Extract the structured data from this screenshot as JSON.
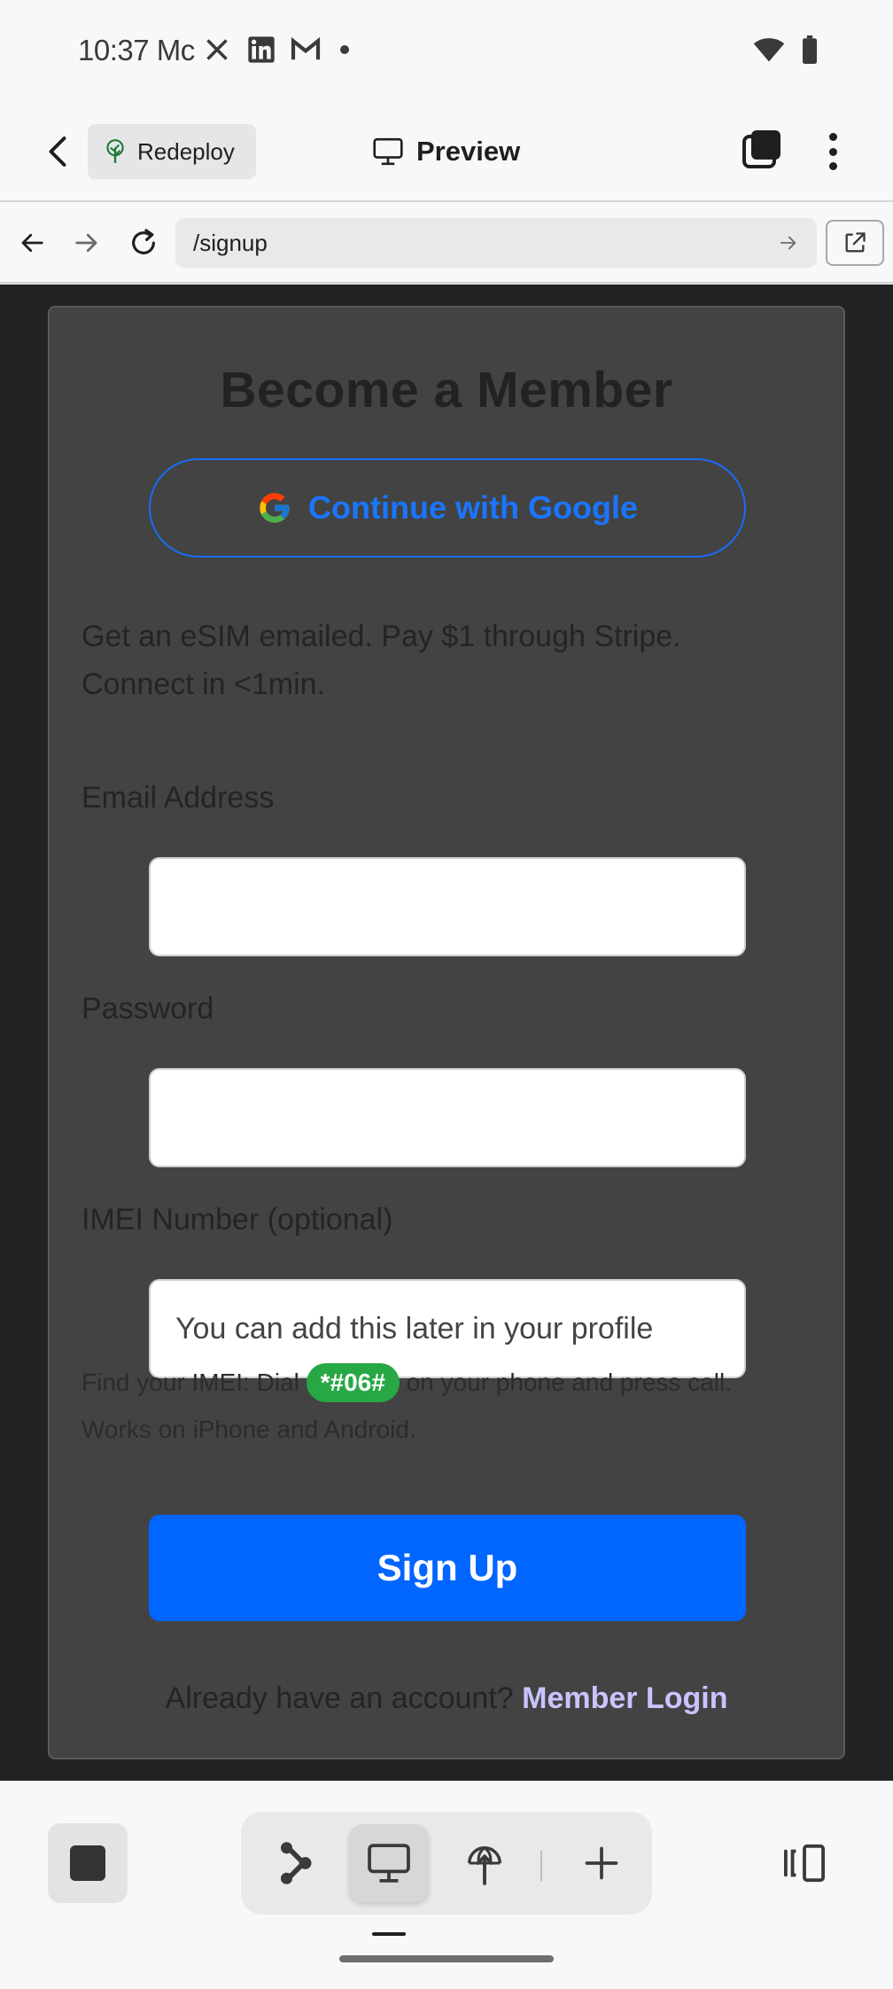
{
  "status_bar": {
    "time": "10:37",
    "carrier_fragment": "Mc",
    "notification_icons": [
      "x-icon",
      "linkedin-icon",
      "gmail-icon"
    ],
    "right_icons": [
      "wifi-icon",
      "battery-icon"
    ]
  },
  "app_bar": {
    "redeploy_label": "Redeploy",
    "title": "Preview"
  },
  "url_bar": {
    "url": "/signup"
  },
  "page": {
    "title": "Become a Member",
    "google_button_label": "Continue with Google",
    "intro_line1": "Get an eSIM emailed. Pay $1 through Stripe.",
    "intro_line2": "Connect in <1min.",
    "email_label": "Email Address",
    "email_value": "",
    "password_label": "Password",
    "password_value": "",
    "imei_label": "IMEI Number (optional)",
    "imei_placeholder": "You can add this later in your profile",
    "hint_prefix": "Find your IMEI: Dial",
    "hint_code": "*#06#",
    "hint_suffix": "on your phone and press call.",
    "hint_line2": "Works on iPhone and Android.",
    "signup_label": "Sign Up",
    "login_prompt": "Already have an account?",
    "login_link": "Member Login"
  },
  "colors": {
    "accent_blue": "#0066ff",
    "google_blue": "#1a75ff",
    "badge_green": "#28a745",
    "link_lavender": "#c9c4ff",
    "card_bg": "#434343",
    "page_bg": "#222222"
  }
}
